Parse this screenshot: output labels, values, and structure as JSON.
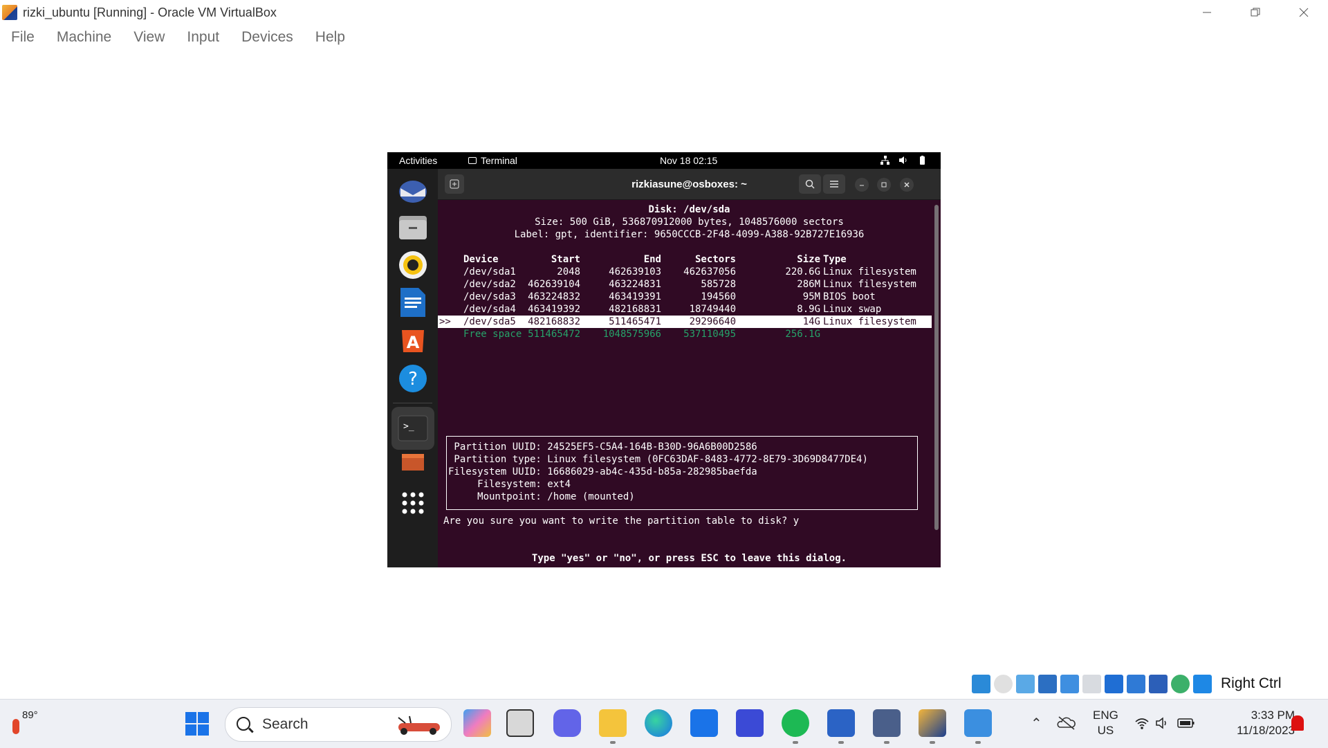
{
  "window": {
    "title": "rizki_ubuntu [Running] - Oracle VM VirtualBox",
    "controls": [
      "minimize-icon",
      "restore-icon",
      "close-icon"
    ]
  },
  "menubar": [
    "File",
    "Machine",
    "View",
    "Input",
    "Devices",
    "Help"
  ],
  "guest": {
    "topbar": {
      "activities": "Activities",
      "app_name": "Terminal",
      "clock": "Nov 18  02:15"
    },
    "terminal": {
      "title": "rizkiasune@osboxes: ~",
      "disk_title": "Disk: /dev/sda",
      "disk_size": "Size: 500 GiB, 536870912000 bytes, 1048576000 sectors",
      "disk_label": "Label: gpt, identifier: 9650CCCB-2F48-4099-A388-92B727E16936",
      "columns": [
        "Device",
        "Start",
        "End",
        "Sectors",
        "Size",
        "Type"
      ],
      "partitions": [
        {
          "marker": "",
          "device": "/dev/sda1",
          "start": "2048",
          "end": "462639103",
          "sectors": "462637056",
          "size": "220.6G",
          "type": "Linux filesystem"
        },
        {
          "marker": "",
          "device": "/dev/sda2",
          "start": "462639104",
          "end": "463224831",
          "sectors": "585728",
          "size": "286M",
          "type": "Linux filesystem"
        },
        {
          "marker": "",
          "device": "/dev/sda3",
          "start": "463224832",
          "end": "463419391",
          "sectors": "194560",
          "size": "95M",
          "type": "BIOS boot"
        },
        {
          "marker": "",
          "device": "/dev/sda4",
          "start": "463419392",
          "end": "482168831",
          "sectors": "18749440",
          "size": "8.9G",
          "type": "Linux swap"
        },
        {
          "marker": ">>",
          "device": "/dev/sda5",
          "start": "482168832",
          "end": "511465471",
          "sectors": "29296640",
          "size": "14G",
          "type": "Linux filesystem"
        },
        {
          "marker": "",
          "device": "Free space",
          "start": "511465472",
          "end": "1048575966",
          "sectors": "537110495",
          "size": "256.1G",
          "type": ""
        }
      ],
      "info": [
        " Partition UUID: 24525EF5-C5A4-164B-B30D-96A6B00D2586",
        " Partition type: Linux filesystem (0FC63DAF-8483-4772-8E79-3D69D8477DE4)",
        "Filesystem UUID: 16686029-ab4c-435d-b85a-282985baefda",
        "     Filesystem: ext4",
        "     Mountpoint: /home (mounted)"
      ],
      "prompt": "Are you sure you want to write the partition table to disk? y",
      "hint": "Type \"yes\" or \"no\", or press ESC to leave this dialog."
    }
  },
  "statusbar": {
    "host_key": "Right Ctrl"
  },
  "taskbar": {
    "weather_temp": "89°",
    "search_placeholder": "Search",
    "lang_line1": "ENG",
    "lang_line2": "US",
    "time": "3:33 PM",
    "date": "11/18/2023"
  },
  "colors": {
    "terminal_bg": "#300a24",
    "free_space": "#26a269",
    "ubuntu_orange": "#e95420"
  }
}
